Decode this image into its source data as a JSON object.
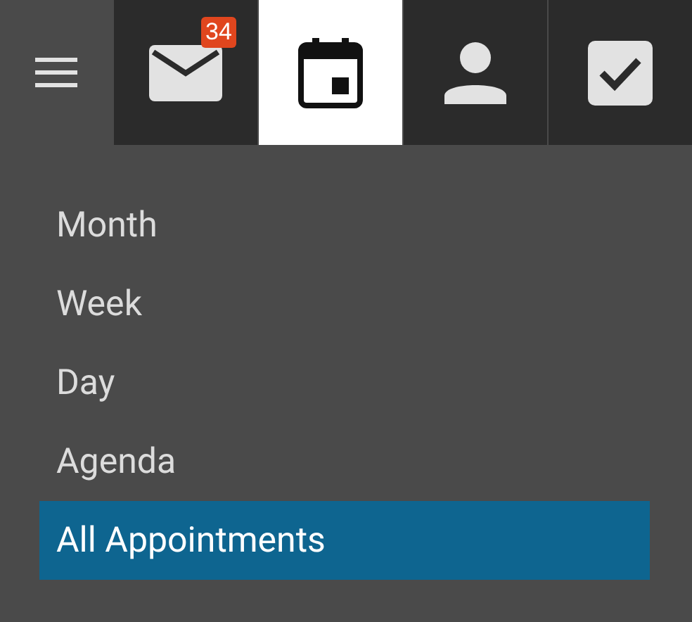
{
  "tabs": [
    {
      "kind": "mail",
      "selected": false,
      "badge": "34"
    },
    {
      "kind": "calendar",
      "selected": true
    },
    {
      "kind": "contacts",
      "selected": false
    },
    {
      "kind": "tasks",
      "selected": false
    }
  ],
  "menu": [
    {
      "label": "Month",
      "selected": false
    },
    {
      "label": "Week",
      "selected": false
    },
    {
      "label": "Day",
      "selected": false
    },
    {
      "label": "Agenda",
      "selected": false
    },
    {
      "label": "All Appointments",
      "selected": true
    }
  ]
}
